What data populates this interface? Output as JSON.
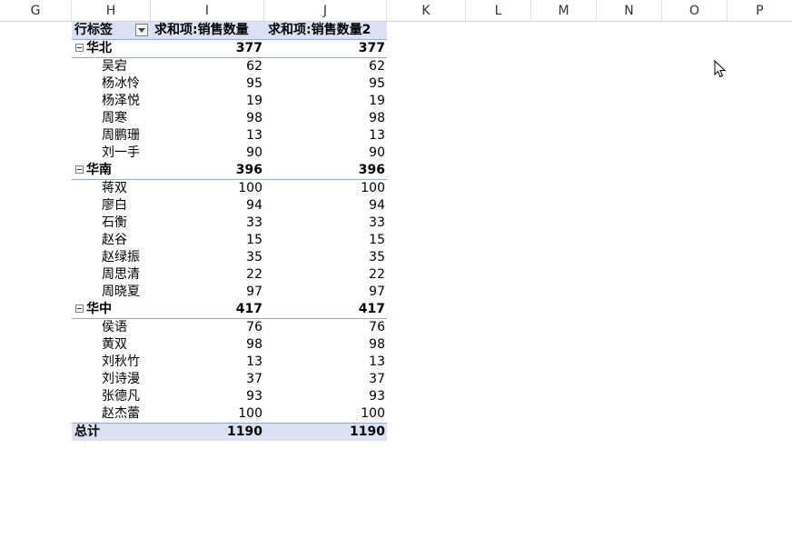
{
  "columns": [
    "G",
    "H",
    "I",
    "J",
    "K",
    "L",
    "M",
    "N",
    "O",
    "P"
  ],
  "pivot": {
    "header": {
      "row_label": "行标签",
      "col1": "求和项:销售数量",
      "col2": "求和项:销售数量2"
    },
    "groups": [
      {
        "name": "华北",
        "v1": "377",
        "v2": "377",
        "items": [
          {
            "name": "吴宕",
            "v1": "62",
            "v2": "62"
          },
          {
            "name": "杨冰怜",
            "v1": "95",
            "v2": "95"
          },
          {
            "name": "杨泽悦",
            "v1": "19",
            "v2": "19"
          },
          {
            "name": "周寒",
            "v1": "98",
            "v2": "98"
          },
          {
            "name": "周鹏珊",
            "v1": "13",
            "v2": "13"
          },
          {
            "name": "刘一手",
            "v1": "90",
            "v2": "90"
          }
        ]
      },
      {
        "name": "华南",
        "v1": "396",
        "v2": "396",
        "items": [
          {
            "name": "蒋双",
            "v1": "100",
            "v2": "100"
          },
          {
            "name": "廖白",
            "v1": "94",
            "v2": "94"
          },
          {
            "name": "石衡",
            "v1": "33",
            "v2": "33"
          },
          {
            "name": "赵谷",
            "v1": "15",
            "v2": "15"
          },
          {
            "name": "赵绿振",
            "v1": "35",
            "v2": "35"
          },
          {
            "name": "周思清",
            "v1": "22",
            "v2": "22"
          },
          {
            "name": "周晓夏",
            "v1": "97",
            "v2": "97"
          }
        ]
      },
      {
        "name": "华中",
        "v1": "417",
        "v2": "417",
        "items": [
          {
            "name": "侯语",
            "v1": "76",
            "v2": "76"
          },
          {
            "name": "黄双",
            "v1": "98",
            "v2": "98"
          },
          {
            "name": "刘秋竹",
            "v1": "13",
            "v2": "13"
          },
          {
            "name": "刘诗漫",
            "v1": "37",
            "v2": "37"
          },
          {
            "name": "张德凡",
            "v1": "93",
            "v2": "93"
          },
          {
            "name": "赵杰蕾",
            "v1": "100",
            "v2": "100"
          }
        ]
      }
    ],
    "total": {
      "label": "总计",
      "v1": "1190",
      "v2": "1190"
    }
  },
  "colors": {
    "pivot_header_bg": "#d9e1f2",
    "pivot_border": "#8ea9db"
  },
  "icons": {
    "filter": "dropdown-filter-icon",
    "collapse": "collapse-minus-icon",
    "cursor": "mouse-pointer-icon"
  }
}
